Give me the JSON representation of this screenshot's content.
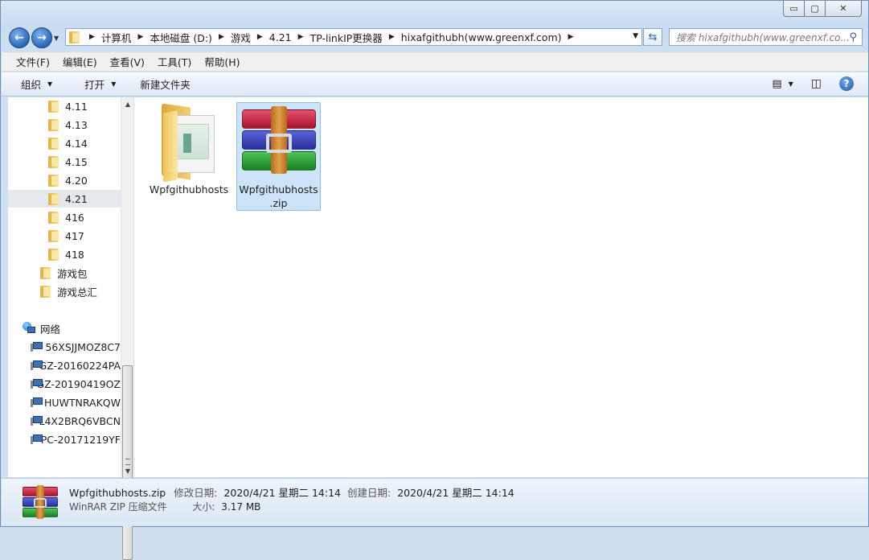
{
  "window": {
    "caption_buttons": [
      "▭",
      "▢",
      "✕"
    ]
  },
  "address": {
    "crumbs": [
      "计算机",
      "本地磁盘 (D:)",
      "游戏",
      "4.21",
      "TP-linkIP更换器",
      "hixafgithubh(www.greenxf.com)"
    ],
    "search_placeholder": "搜索 hixafgithubh(www.greenxf.co..."
  },
  "menubar": {
    "items": [
      "文件(F)",
      "编辑(E)",
      "查看(V)",
      "工具(T)",
      "帮助(H)"
    ]
  },
  "commandbar": {
    "organize": "组织",
    "open": "打开",
    "new_folder": "新建文件夹"
  },
  "navpane": {
    "folders": [
      "4.11",
      "4.13",
      "4.14",
      "4.15",
      "4.20",
      "4.21",
      "416",
      "417",
      "418"
    ],
    "selected": "4.21",
    "groups": [
      "游戏包",
      "游戏总汇"
    ],
    "network_label": "网络",
    "computers": [
      "56XSJJMOZ8C7",
      "GZ-20160224PA",
      "GZ-20190419OZ",
      "HUWTNRAKQW",
      "L4X2BRQ6VBCN",
      "PC-20171219YF"
    ]
  },
  "files": [
    {
      "name": "Wpfgithubhosts",
      "type": "folder",
      "icon": "folder-icon",
      "selected": false
    },
    {
      "name_line1": "Wpfgithubhosts",
      "name_line2": ".zip",
      "type": "zip",
      "icon": "winrar-icon",
      "selected": true
    }
  ],
  "details": {
    "name": "Wpfgithubhosts.zip",
    "modified_label": "修改日期:",
    "modified": "2020/4/21 星期二 14:14",
    "created_label": "创建日期:",
    "created": "2020/4/21 星期二 14:14",
    "type": "WinRAR ZIP 压缩文件",
    "size_label": "大小:",
    "size": "3.17 MB"
  },
  "colors": {
    "selection": "#cce4f7",
    "selection_border": "#8fb8de",
    "chrome": "#cfe0f3"
  }
}
